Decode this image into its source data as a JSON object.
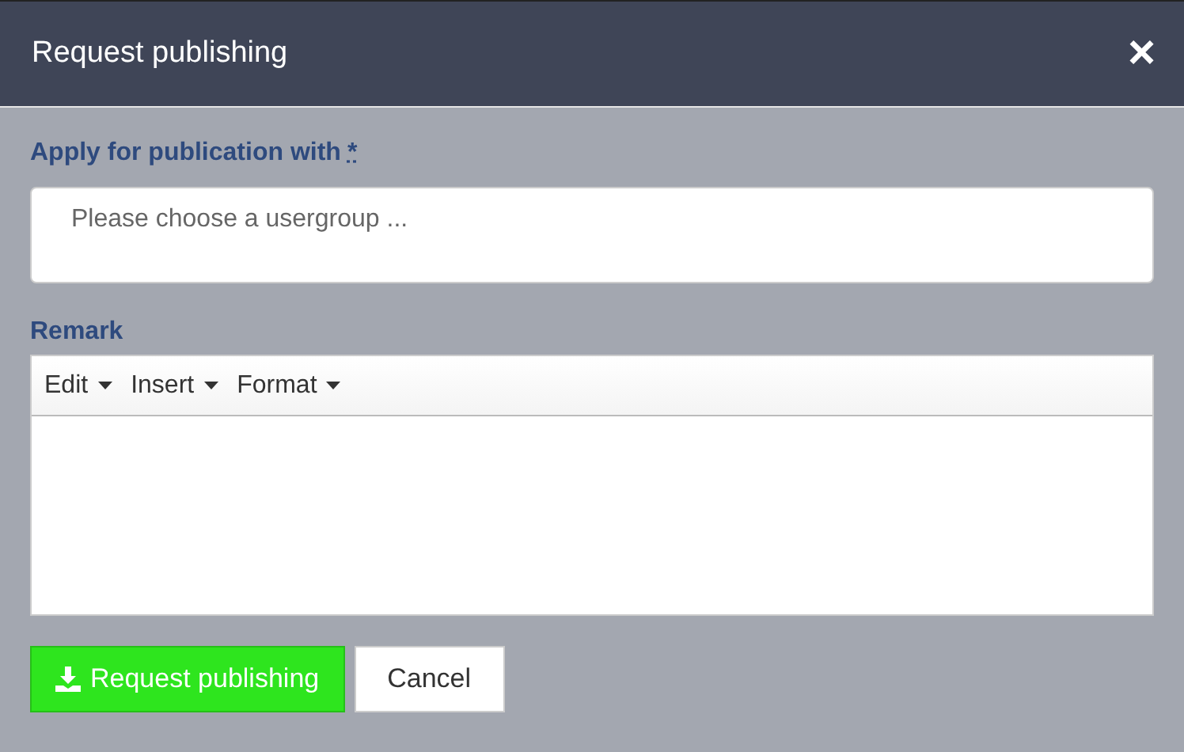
{
  "window": {
    "title": "Request publishing",
    "close": "×"
  },
  "usergroup": {
    "label": "Apply for publication with",
    "required_mark": "*",
    "placeholder": "Please choose a usergroup ..."
  },
  "remark": {
    "label": "Remark",
    "menus": [
      "Edit",
      "Insert",
      "Format"
    ]
  },
  "buttons": [
    {
      "label": "Request publishing",
      "kind": "primary"
    },
    {
      "label": "Cancel",
      "kind": "default"
    }
  ]
}
